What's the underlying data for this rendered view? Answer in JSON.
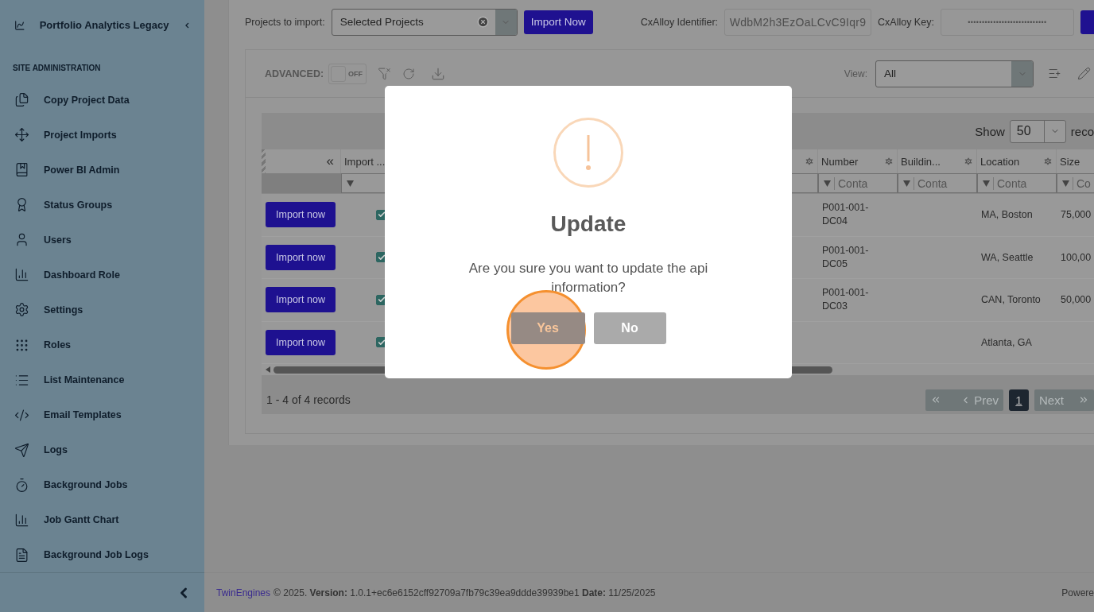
{
  "sidebar": {
    "app_title": "Portfolio Analytics Legacy",
    "section": "SITE ADMINISTRATION",
    "items": [
      {
        "label": "Copy Project Data"
      },
      {
        "label": "Project Imports"
      },
      {
        "label": "Power BI Admin"
      },
      {
        "label": "Status Groups"
      },
      {
        "label": "Users"
      },
      {
        "label": "Dashboard Role"
      },
      {
        "label": "Settings"
      },
      {
        "label": "Roles"
      },
      {
        "label": "List Maintenance"
      },
      {
        "label": "Email Templates"
      },
      {
        "label": "Logs"
      },
      {
        "label": "Background Jobs"
      },
      {
        "label": "Job Gantt Chart"
      },
      {
        "label": "Background Job Logs"
      }
    ]
  },
  "import_bar": {
    "label": "Projects to import:",
    "select_value": "Selected Projects",
    "button": "Import Now",
    "identifier_label": "CxAlloy Identifier:",
    "identifier_value": "WdbM2h3EzOaLCvC9Iqr9",
    "key_label": "CxAlloy Key:",
    "key_value": "••••••••••••••••••••••••••••"
  },
  "grid_toolbar": {
    "advanced_label": "ADVANCED:",
    "advanced_on": false,
    "toggle_text": "OFF",
    "view_label": "View:",
    "view_value": "All"
  },
  "grid": {
    "show_label": "Show",
    "page_size": "50",
    "records_label": "reco",
    "columns": [
      {
        "kind": "action",
        "label": "«"
      },
      {
        "kind": "check",
        "label": "Import ..."
      },
      {
        "kind": "text",
        "menu_icon": true
      },
      {
        "kind": "text",
        "label": "Number",
        "menu_icon": true,
        "placeholder": "Conta"
      },
      {
        "kind": "text",
        "label": "Buildin...",
        "menu_icon": true,
        "placeholder": "Conta"
      },
      {
        "kind": "text",
        "label": "Location",
        "menu_icon": true,
        "placeholder": "Conta"
      },
      {
        "kind": "text",
        "label": "Size",
        "placeholder": "Co"
      }
    ],
    "rows": [
      {
        "action": "Import now",
        "checked": true,
        "number": "P001-001-DC04",
        "location": "MA, Boston",
        "size": "75,000"
      },
      {
        "action": "Import now",
        "checked": true,
        "number": "P001-001-DC05",
        "location": "WA, Seattle",
        "size": "100,00"
      },
      {
        "action": "Import now",
        "checked": true,
        "number": "P001-001-DC03",
        "location": "CAN, Toronto",
        "size": "50,000"
      },
      {
        "action": "Import now",
        "checked": true,
        "location": "Atlanta, GA"
      }
    ],
    "records": "1 - 4 of 4 records",
    "pager": {
      "prev": {
        "label": "Prev",
        "disabled": true
      },
      "pages": [
        {
          "label": "1",
          "selected": true
        }
      ],
      "next": {
        "label": "Next",
        "disabled": true
      }
    }
  },
  "modal": {
    "title": "Update",
    "message": "Are you sure you want to update the api information?",
    "buttons": [
      {
        "label": "Yes",
        "kind": "confirm",
        "highlighted": true
      },
      {
        "label": "No",
        "kind": "cancel",
        "highlighted": false
      }
    ]
  },
  "footer": {
    "link": "TwinEngines",
    "text": "© 2025. **Version:** 1.0.1+ec6e6152cff92709a7fb79c39ea9ddde39939be1 **Date:** 11/25/2025",
    "powered": "Powere"
  }
}
